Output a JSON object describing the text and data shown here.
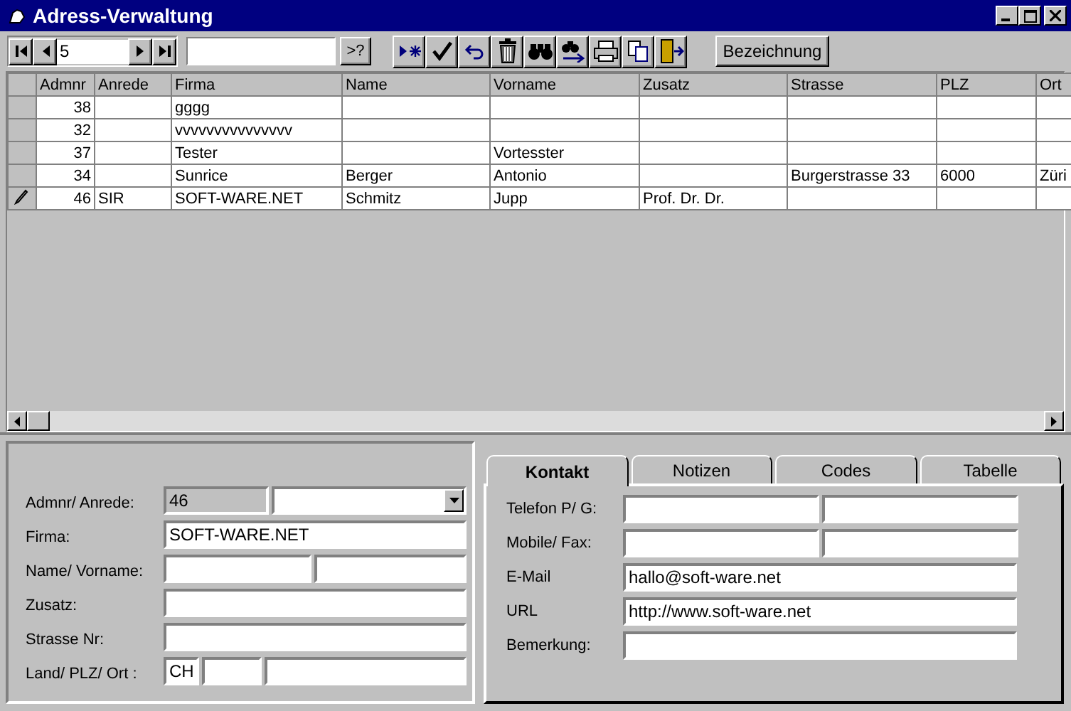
{
  "window": {
    "title": "Adress-Verwaltung"
  },
  "toolbar": {
    "record_number": "5",
    "query_button": ">?",
    "sort_button": "Bezeichnung"
  },
  "table": {
    "columns": [
      "Admnr",
      "Anrede",
      "Firma",
      "Name",
      "Vorname",
      "Zusatz",
      "Strasse",
      "PLZ",
      "Ort"
    ],
    "rows": [
      {
        "current": false,
        "cells": [
          "38",
          "",
          "gggg",
          "",
          "",
          "",
          "",
          "",
          ""
        ]
      },
      {
        "current": false,
        "cells": [
          "32",
          "",
          "vvvvvvvvvvvvvvv",
          "",
          "",
          "",
          "",
          "",
          ""
        ]
      },
      {
        "current": false,
        "cells": [
          "37",
          "",
          "Tester",
          "",
          "Vortesster",
          "",
          "",
          "",
          ""
        ]
      },
      {
        "current": false,
        "cells": [
          "34",
          "",
          "Sunrice",
          "Berger",
          "Antonio",
          "",
          "Burgerstrasse 33",
          "6000",
          "Züri"
        ]
      },
      {
        "current": true,
        "cells": [
          "46",
          "SIR",
          "SOFT-WARE.NET",
          "Schmitz",
          "Jupp",
          "Prof. Dr. Dr.",
          "",
          "",
          ""
        ]
      }
    ]
  },
  "form": {
    "admnr_label": "Admnr/ Anrede:",
    "admnr": "46",
    "firma_label": "Firma:",
    "firma": "SOFT-WARE.NET",
    "name_label": "Name/ Vorname:",
    "zusatz_label": "Zusatz:",
    "strasse_label": "Strasse Nr:",
    "ort_label": "Land/ PLZ/ Ort :",
    "land": "CH"
  },
  "tabs": [
    {
      "label": "Kontakt",
      "selected": true
    },
    {
      "label": "Notizen",
      "selected": false
    },
    {
      "label": "Codes",
      "selected": false
    },
    {
      "label": "Tabelle",
      "selected": false
    }
  ],
  "contact": {
    "telefon_label": "Telefon P/ G:",
    "mobile_label": "Mobile/ Fax:",
    "email_label": "E-Mail",
    "email": "hallo@soft-ware.net",
    "url_label": "URL",
    "url": "http://www.soft-ware.net",
    "bemerkung_label": "Bemerkung:"
  }
}
